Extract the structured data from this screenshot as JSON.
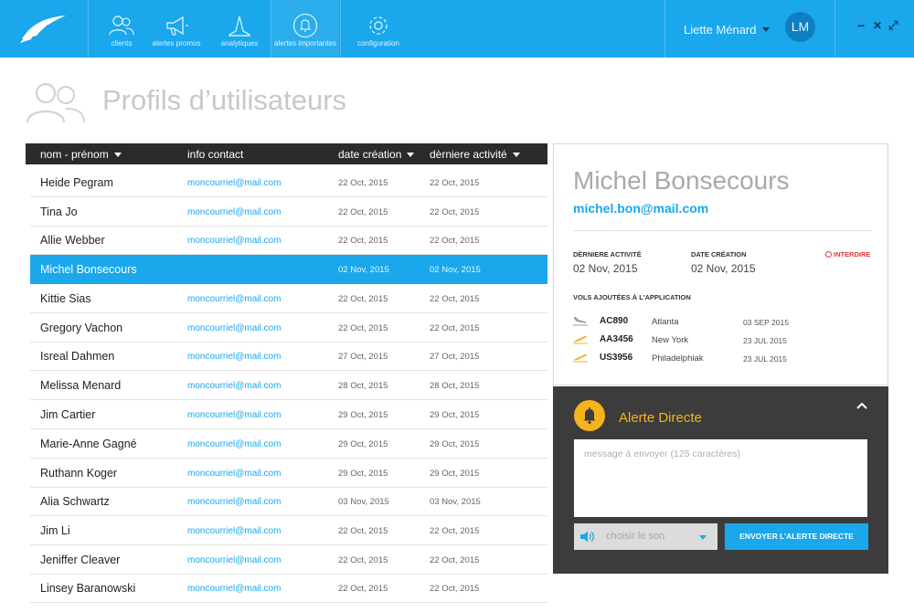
{
  "brand": {
    "accent": "#1aa7ec",
    "alert_accent": "#f6b31b",
    "danger": "#e53935",
    "dark": "#2b2b2b"
  },
  "nav": [
    {
      "label": "clients",
      "icon": "users-icon"
    },
    {
      "label": "alertes promos",
      "icon": "megaphone-icon"
    },
    {
      "label": "analytiques",
      "icon": "analytics-icon"
    },
    {
      "label": "alertes importantes",
      "icon": "bell-icon"
    },
    {
      "label": "configuration",
      "icon": "gear-icon"
    }
  ],
  "user": {
    "name": "Liette Ménard",
    "initials": "LM"
  },
  "window": {
    "minimize": "−",
    "close": "✕",
    "maximize": "⤢"
  },
  "page": {
    "title": "Profils d’utilisateurs"
  },
  "table": {
    "headers": {
      "name": "nom - prénom",
      "contact": "info contact",
      "created": "date création",
      "last": "dèrniere activité"
    },
    "rows": [
      {
        "name": "Heide Pegram",
        "email": "moncourriel@mail.com",
        "created": "22 Oct, 2015",
        "last": "22 Oct, 2015"
      },
      {
        "name": "Tina Jo",
        "email": "moncourriel@mail.com",
        "created": "22 Oct, 2015",
        "last": "22 Oct, 2015"
      },
      {
        "name": "Allie Webber",
        "email": "moncourriel@mail.com",
        "created": "22 Oct, 2015",
        "last": "22 Oct, 2015"
      },
      {
        "name": "Michel Bonsecours",
        "email": "",
        "created": "02 Nov, 2015",
        "last": "02 Nov, 2015"
      },
      {
        "name": "Kittie Sias",
        "email": "moncourriel@mail.com",
        "created": "22 Oct, 2015",
        "last": "22 Oct, 2015"
      },
      {
        "name": "Gregory Vachon",
        "email": "moncourriel@mail.com",
        "created": "22 Oct, 2015",
        "last": "22 Oct, 2015"
      },
      {
        "name": "Isreal Dahmen",
        "email": "moncourriel@mail.com",
        "created": "27 Oct, 2015",
        "last": "27 Oct, 2015"
      },
      {
        "name": "Melissa Menard",
        "email": "moncourriel@mail.com",
        "created": "28 Oct, 2015",
        "last": "28 Oct, 2015"
      },
      {
        "name": "Jim Cartier",
        "email": "moncourriel@mail.com",
        "created": "29 Oct, 2015",
        "last": "29 Oct, 2015"
      },
      {
        "name": "Marie-Anne Gagné",
        "email": "moncourriel@mail.com",
        "created": "29 Oct, 2015",
        "last": "29 Oct, 2015"
      },
      {
        "name": "Ruthann Koger",
        "email": "moncourriel@mail.com",
        "created": "29 Oct, 2015",
        "last": "29 Oct, 2015"
      },
      {
        "name": "Alia Schwartz",
        "email": "moncourriel@mail.com",
        "created": "03 Nov, 2015",
        "last": "03 Nov, 2015"
      },
      {
        "name": "Jim Li",
        "email": "moncourriel@mail.com",
        "created": "22 Oct, 2015",
        "last": "22 Oct, 2015"
      },
      {
        "name": "Jeniffer Cleaver",
        "email": "moncourriel@mail.com",
        "created": "22 Oct, 2015",
        "last": "22 Oct, 2015"
      },
      {
        "name": "Linsey Baranowski",
        "email": "moncourriel@mail.com",
        "created": "22 Oct, 2015",
        "last": "22 Oct, 2015"
      }
    ]
  },
  "detail": {
    "name": "Michel Bonsecours",
    "email": "michel.bon@mail.com",
    "last_activity_label": "DÈRNIERE ACTIVITÉ",
    "last_activity": "02 Nov, 2015",
    "created_label": "DATE CRÉATION",
    "created": "02 Nov, 2015",
    "ban_label": "INTERDIRE",
    "flights_title": "VOLS AJOUTÉES À L’APPLICATION",
    "flights": [
      {
        "code": "AC890",
        "city": "Atlanta",
        "date": "03 SEP 2015",
        "status": "landed",
        "icon": "plane-landing-icon"
      },
      {
        "code": "AA3456",
        "city": "New York",
        "date": "23 JUL 2015",
        "status": "active",
        "icon": "plane-takeoff-icon"
      },
      {
        "code": "US3956",
        "city": "Philadelphiak",
        "date": "23 JUL 2015",
        "status": "active",
        "icon": "plane-takeoff-icon"
      }
    ]
  },
  "alert": {
    "title": "Alerte Directe",
    "placeholder": "message à envoyer (125 caractères)",
    "sound_placeholder": "choisir  le son",
    "send_label": "ENVOYER L’ALERTE DIRECTE"
  }
}
